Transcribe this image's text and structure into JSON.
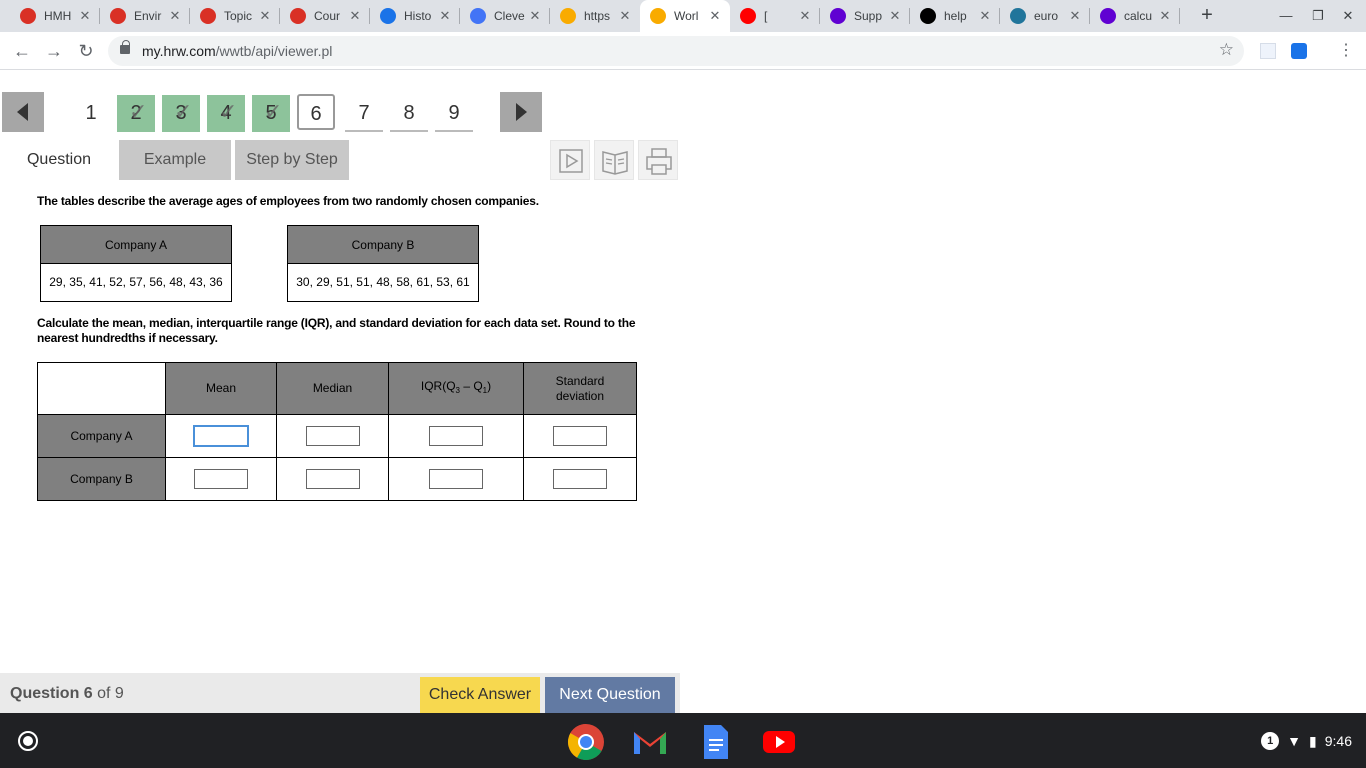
{
  "browser": {
    "tabs": [
      {
        "label": "HMH",
        "icon": "hmh-favicon",
        "color": "#d93025"
      },
      {
        "label": "Envir",
        "icon": "hmh-favicon",
        "color": "#d93025"
      },
      {
        "label": "Topic",
        "icon": "hmh-favicon",
        "color": "#d93025"
      },
      {
        "label": "Cour",
        "icon": "hmh-favicon",
        "color": "#d93025"
      },
      {
        "label": "Histo",
        "icon": "history-favicon",
        "color": "#1a73e8"
      },
      {
        "label": "Cleve",
        "icon": "clever-favicon",
        "color": "#4274f6"
      },
      {
        "label": "https",
        "icon": "dot-favicon",
        "color": "#f9ab00"
      },
      {
        "label": "Worl",
        "icon": "dot-favicon",
        "color": "#f9ab00"
      },
      {
        "label": "[",
        "icon": "youtube-favicon",
        "color": "#ff0000"
      },
      {
        "label": "Supp",
        "icon": "yahoo-favicon",
        "color": "#6001d2"
      },
      {
        "label": "help",
        "icon": "brainly-favicon",
        "color": "#000000"
      },
      {
        "label": "euro",
        "icon": "wordpress-favicon",
        "color": "#21759b"
      },
      {
        "label": "calcu",
        "icon": "yahoo-favicon",
        "color": "#6001d2"
      }
    ],
    "active_tab": 7,
    "url_host": "my.hrw.com",
    "url_path": "/wwtb/api/viewer.pl"
  },
  "question_nav": {
    "numbers": [
      "1",
      "2",
      "3",
      "4",
      "5",
      "6",
      "7",
      "8",
      "9"
    ],
    "states": [
      "plain",
      "done",
      "done",
      "done",
      "done",
      "current",
      "todo",
      "todo",
      "todo"
    ]
  },
  "mode_tabs": {
    "question": "Question",
    "example": "Example",
    "step_by_step": "Step by Step"
  },
  "problem": {
    "intro": "The tables describe the average ages of employees from two randomly chosen companies.",
    "company_a": {
      "header": "Company A",
      "values": "29, 35, 41, 52, 57, 56, 48, 43, 36"
    },
    "company_b": {
      "header": "Company B",
      "values": "30, 29, 51, 51, 48, 58, 61, 53, 61"
    },
    "instruction": "Calculate the mean, median, interquartile range (IQR), and standard deviation for each data set. Round to the nearest hundredths if necessary.",
    "answer_table": {
      "col_mean": "Mean",
      "col_median": "Median",
      "col_iqr_prefix": "IQR(Q",
      "col_iqr_sub1": "3",
      "col_iqr_mid": " – Q",
      "col_iqr_sub2": "1",
      "col_iqr_suffix": ")",
      "col_sd_line1": "Standard",
      "col_sd_line2": "deviation",
      "row_a": "Company A",
      "row_b": "Company B"
    }
  },
  "footer": {
    "question_label": "Question 6",
    "of_label": " of 9",
    "check_answer": "Check Answer",
    "next_question": "Next Question"
  },
  "shelf": {
    "notification_count": "1",
    "time": "9:46"
  }
}
